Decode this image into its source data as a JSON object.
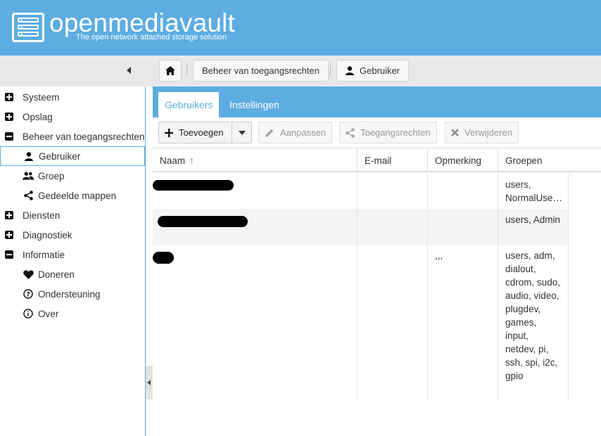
{
  "brand": {
    "title": "openmediavault",
    "subtitle": "The open network attached storage solution"
  },
  "breadcrumb": {
    "home_icon": "home-icon",
    "items": [
      "Beheer van toegangsrechten",
      "Gebruiker"
    ]
  },
  "sidebar": {
    "items": [
      {
        "label": "Systeem",
        "level": 1,
        "expander": "plus"
      },
      {
        "label": "Opslag",
        "level": 1,
        "expander": "plus"
      },
      {
        "label": "Beheer van toegangsrechten",
        "level": 1,
        "expander": "minus"
      },
      {
        "label": "Gebruiker",
        "level": 2,
        "icon": "user-icon",
        "active": true
      },
      {
        "label": "Groep",
        "level": 2,
        "icon": "group-icon"
      },
      {
        "label": "Gedeelde mappen",
        "level": 2,
        "icon": "share-icon"
      },
      {
        "label": "Diensten",
        "level": 1,
        "expander": "plus"
      },
      {
        "label": "Diagnostiek",
        "level": 1,
        "expander": "plus"
      },
      {
        "label": "Informatie",
        "level": 1,
        "expander": "minus"
      },
      {
        "label": "Doneren",
        "level": 2,
        "icon": "heart-icon"
      },
      {
        "label": "Ondersteuning",
        "level": 2,
        "icon": "question-icon"
      },
      {
        "label": "Over",
        "level": 2,
        "icon": "info-icon"
      }
    ]
  },
  "tabs": [
    "Gebruikers",
    "Instellingen"
  ],
  "toolbar": {
    "add": "Toevoegen",
    "edit": "Aanpassen",
    "privileges": "Toegangsrechten",
    "delete": "Verwijderen"
  },
  "grid": {
    "columns": [
      "Naam",
      "E-mail",
      "Opmerking",
      "Groepen"
    ],
    "sort_indicator": "↑",
    "rows": [
      {
        "name": "",
        "email": "",
        "comment": "",
        "groups": "users, NormalUse…"
      },
      {
        "name": "",
        "email": "",
        "comment": "",
        "groups": "users, Admin"
      },
      {
        "name": "",
        "email": "",
        "comment": ",,,",
        "groups": "users, adm, dialout, cdrom, sudo, audio, video, plugdev, games, input, netdev, pi, ssh, spi, i2c, gpio"
      }
    ]
  },
  "colors": {
    "accent": "#5dade2",
    "header_bg": "#5dade2",
    "toolbar_bg": "#e8e8e8"
  }
}
